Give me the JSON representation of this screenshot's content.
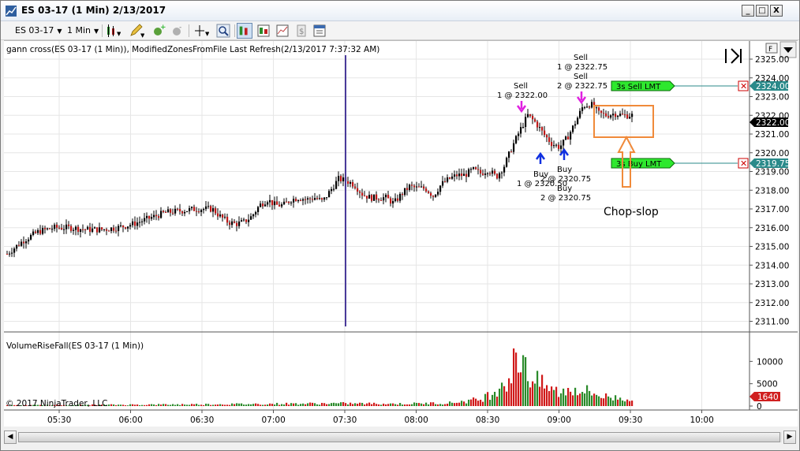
{
  "window": {
    "title": "ES 03-17 (1 Min)  2/13/2017",
    "buttons": [
      "_",
      "□",
      "X"
    ]
  },
  "toolbar": {
    "instrument": "ES 03-17",
    "interval": "1 Min",
    "icons": [
      "candlestick-icon",
      "pencil-icon",
      "add-indicator-icon",
      "remove-indicator-icon",
      "crosshair-icon",
      "zoom-icon",
      "bar-style-icon",
      "data-box-icon",
      "chart-style-icon",
      "strategy-icon",
      "properties-icon"
    ]
  },
  "price_panel": {
    "indicator_label": "gann cross(ES 03-17 (1 Min)), ModifiedZonesFromFile Last Refresh(2/13/2017 7:37:32 AM)",
    "f_button": "F",
    "y_ticks": [
      "2311.00",
      "2312.00",
      "2313.00",
      "2314.00",
      "2315.00",
      "2316.00",
      "2317.00",
      "2318.00",
      "2319.00",
      "2320.00",
      "2321.00",
      "2322.00",
      "2323.00",
      "2324.00",
      "2325.00"
    ],
    "current_price": "2322.00",
    "sell_order": {
      "label": "3s  Sell LMT",
      "price": "2324.00",
      "color": "#2a8a8a"
    },
    "buy_order": {
      "label": "3s  Buy LMT",
      "price": "2319.75",
      "color": "#2a8a8a"
    },
    "annotations": {
      "sell1_a": "Sell",
      "sell1_b": "1 @ 2322.00",
      "sell2_a": "Sell",
      "sell2_b": "1 @ 2322.75",
      "sell3_a": "Sell",
      "sell3_b": "2 @ 2322.75",
      "buy1_a": "Buy",
      "buy1_b": "1 @ 2320.50",
      "buy2_a": "Buy",
      "buy2_b": "2 @ 2320.75",
      "buy3_a": "Buy",
      "buy3_b": "2 @ 2320.75",
      "chop": "Chop-slop"
    }
  },
  "volume_panel": {
    "label": "VolumeRiseFall(ES 03-17 (1 Min))",
    "y_ticks": [
      "0",
      "5000",
      "10000"
    ],
    "current_volume": "1640",
    "copyright": "© 2017 NinjaTrader, LLC"
  },
  "x_axis": {
    "ticks": [
      "05:30",
      "06:00",
      "06:30",
      "07:00",
      "07:30",
      "08:00",
      "08:30",
      "09:00",
      "09:30",
      "10:00"
    ]
  },
  "chart_data": {
    "type": "bar",
    "title": "",
    "price_y_range": [
      2310.6,
      2325.8
    ],
    "price_path": [
      [
        0,
        2314.6
      ],
      [
        20,
        2315.3
      ],
      [
        40,
        2315.8
      ],
      [
        60,
        2316.0
      ],
      [
        80,
        2316.0
      ],
      [
        100,
        2315.9
      ],
      [
        120,
        2315.9
      ],
      [
        140,
        2316.0
      ],
      [
        160,
        2316.2
      ],
      [
        180,
        2316.5
      ],
      [
        200,
        2316.8
      ],
      [
        220,
        2316.9
      ],
      [
        240,
        2317.0
      ],
      [
        260,
        2317.0
      ],
      [
        270,
        2316.6
      ],
      [
        280,
        2316.3
      ],
      [
        290,
        2316.2
      ],
      [
        300,
        2316.3
      ],
      [
        310,
        2316.6
      ],
      [
        320,
        2317.2
      ],
      [
        330,
        2317.5
      ],
      [
        340,
        2317.2
      ],
      [
        350,
        2317.2
      ],
      [
        360,
        2317.5
      ],
      [
        370,
        2317.6
      ],
      [
        380,
        2317.5
      ],
      [
        390,
        2317.6
      ],
      [
        400,
        2317.4
      ],
      [
        410,
        2318.0
      ],
      [
        420,
        2318.6
      ],
      [
        430,
        2318.5
      ],
      [
        440,
        2318.3
      ],
      [
        450,
        2317.8
      ],
      [
        460,
        2317.6
      ],
      [
        470,
        2317.6
      ],
      [
        480,
        2317.6
      ],
      [
        490,
        2317.3
      ],
      [
        500,
        2317.8
      ],
      [
        510,
        2318.2
      ],
      [
        520,
        2318.1
      ],
      [
        530,
        2318.1
      ],
      [
        540,
        2317.7
      ],
      [
        550,
        2318.3
      ],
      [
        560,
        2318.6
      ],
      [
        570,
        2318.8
      ],
      [
        580,
        2318.8
      ],
      [
        590,
        2319.1
      ],
      [
        600,
        2318.9
      ],
      [
        610,
        2319.1
      ],
      [
        620,
        2318.7
      ],
      [
        630,
        2319.3
      ],
      [
        640,
        2320.3
      ],
      [
        650,
        2321.2
      ],
      [
        660,
        2322.0
      ],
      [
        670,
        2321.6
      ],
      [
        680,
        2321.0
      ],
      [
        690,
        2320.5
      ],
      [
        700,
        2320.3
      ],
      [
        710,
        2320.8
      ],
      [
        720,
        2321.6
      ],
      [
        730,
        2322.5
      ],
      [
        740,
        2322.6
      ],
      [
        750,
        2322.1
      ],
      [
        760,
        2322.0
      ],
      [
        770,
        2322.1
      ],
      [
        780,
        2322.0
      ],
      [
        790,
        2322.0
      ],
      [
        796,
        2322.0
      ]
    ],
    "volume_path": [
      [
        0,
        150
      ],
      [
        150,
        300
      ],
      [
        300,
        450
      ],
      [
        420,
        600
      ],
      [
        500,
        500
      ],
      [
        560,
        700
      ],
      [
        600,
        1500
      ],
      [
        615,
        3000
      ],
      [
        625,
        5000
      ],
      [
        635,
        6000
      ],
      [
        645,
        7500
      ],
      [
        655,
        9000
      ],
      [
        665,
        6000
      ],
      [
        680,
        4500
      ],
      [
        700,
        3000
      ],
      [
        720,
        4000
      ],
      [
        740,
        3000
      ],
      [
        760,
        2000
      ],
      [
        780,
        1800
      ],
      [
        796,
        1640
      ]
    ],
    "volume_y_range": [
      0,
      12000
    ],
    "vertical_marker_time": "07:30"
  }
}
